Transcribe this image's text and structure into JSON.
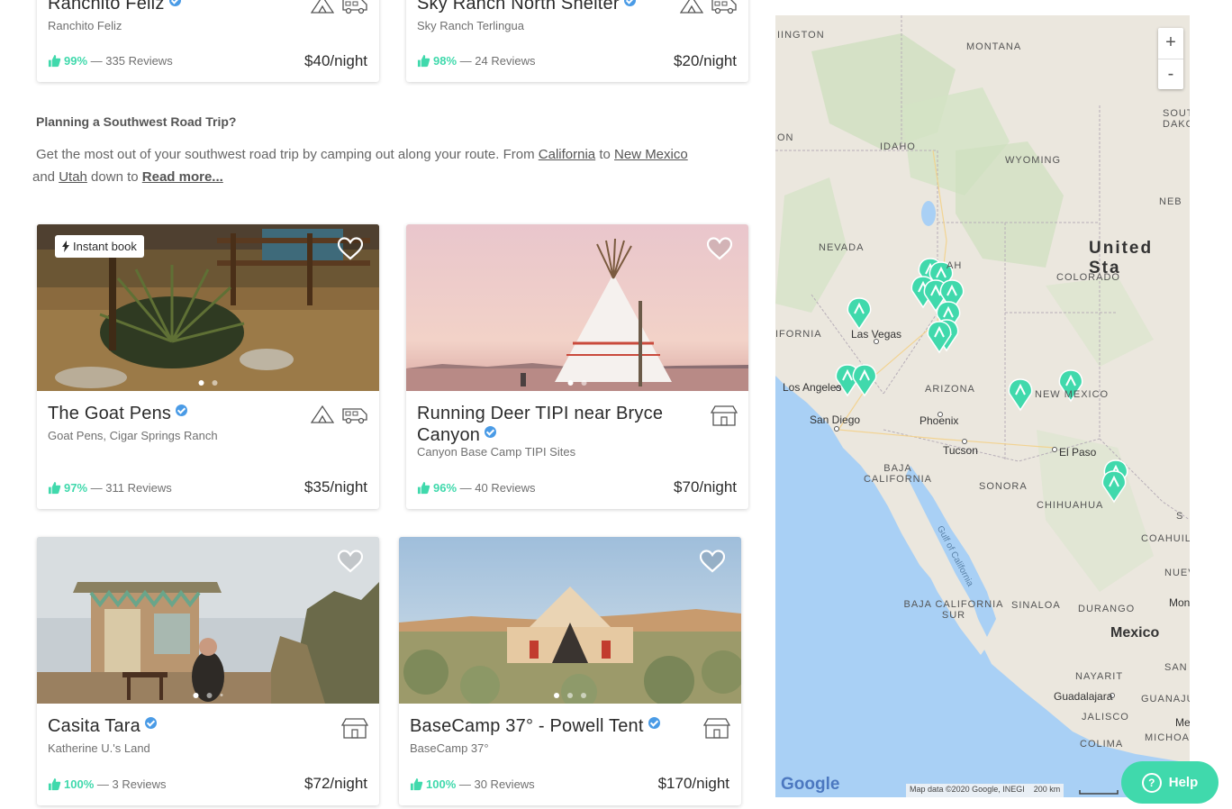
{
  "top_cards": [
    {
      "title": "Ranchito Feliz",
      "location": "Ranchito Feliz",
      "rating_pct": "99%",
      "reviews": "— 335 Reviews",
      "price": "$40/night",
      "icons": [
        "tent-icon",
        "rv-icon"
      ]
    },
    {
      "title": "Sky Ranch North Shelter",
      "location": "Sky Ranch Terlingua",
      "rating_pct": "98%",
      "reviews": "— 24 Reviews",
      "price": "$20/night",
      "icons": [
        "tent-icon",
        "rv-icon"
      ]
    }
  ],
  "section": {
    "title": "Planning a Southwest Road Trip?",
    "text_1": "Get the most out of your southwest road trip by camping out along your route. From ",
    "link_california": "California",
    "text_2": " to ",
    "link_new_mexico": "New Mexico",
    "text_3": " and ",
    "link_utah": "Utah",
    "text_4": " down to ",
    "read_more": "Read more..."
  },
  "listings": [
    {
      "title": "The Goat Pens",
      "location": "Goat Pens, Cigar Springs Ranch",
      "rating_pct": "97%",
      "reviews": "— 311 Reviews",
      "price": "$35/night",
      "instant_book": "Instant book",
      "icons": [
        "tent-icon",
        "rv-icon"
      ]
    },
    {
      "title": "Running Deer TIPI near Bryce Canyon",
      "location": "Canyon Base Camp TIPI Sites",
      "rating_pct": "96%",
      "reviews": "— 40 Reviews",
      "price": "$70/night",
      "icons": [
        "cabin-icon"
      ]
    },
    {
      "title": "Casita Tara",
      "location": "Katherine U.'s Land",
      "rating_pct": "100%",
      "reviews": "— 3 Reviews",
      "price": "$72/night",
      "icons": [
        "cabin-icon"
      ]
    },
    {
      "title": "BaseCamp 37° - Powell Tent",
      "location": "BaseCamp 37°",
      "rating_pct": "100%",
      "reviews": "— 30 Reviews",
      "price": "$170/night",
      "icons": [
        "cabin-icon"
      ]
    }
  ],
  "map": {
    "zoom_in": "+",
    "zoom_out": "-",
    "google_logo": "Google",
    "attribution": "Map data ©2020 Google, INEGI",
    "scale": "200 km",
    "labels": {
      "washington": "IINGTON",
      "montana": "MONTANA",
      "south_dakota": "SOUT DAKO",
      "oregon": "ON",
      "idaho": "IDAHO",
      "wyoming": "WYOMING",
      "nebraska": "NEB",
      "nevada": "NEVADA",
      "utah": "AH",
      "united_states": "United Sta",
      "colorado": "COLORADO",
      "california": "IFORNIA",
      "las_vegas": "Las Vegas",
      "los_angeles": "Los Angeles",
      "arizona": "ARIZONA",
      "new_mexico": "NEW MEXICO",
      "san_diego": "San Diego",
      "phoenix": "Phoenix",
      "tucson": "Tucson",
      "el_paso": "El Paso",
      "baja_california": "BAJA CALIFORNIA",
      "sonora": "SONORA",
      "chihuahua": "CHIHUAHUA",
      "coahuila": "COAHUILA",
      "gulf_of_california": "Gulf of California",
      "nuevo": "NUEVO",
      "monte": "Monte",
      "baja_california_sur": "BAJA CALIFORNIA SUR",
      "sinaloa": "SINALOA",
      "durango": "DURANGO",
      "mexico": "Mexico",
      "nayarit": "NAYARIT",
      "san": "SAN",
      "guadalajara": "Guadalajara",
      "guanaju": "GUANAJU",
      "jalisco": "JALISCO",
      "colima": "COLIMA",
      "michoaca": "MICHOACA",
      "me": "Me",
      "s": "S"
    }
  },
  "help": {
    "label": "Help"
  },
  "colors": {
    "accent": "#40d9ac",
    "verified": "#4a9be6",
    "water": "#a9d0f5",
    "land": "#ece8df"
  }
}
